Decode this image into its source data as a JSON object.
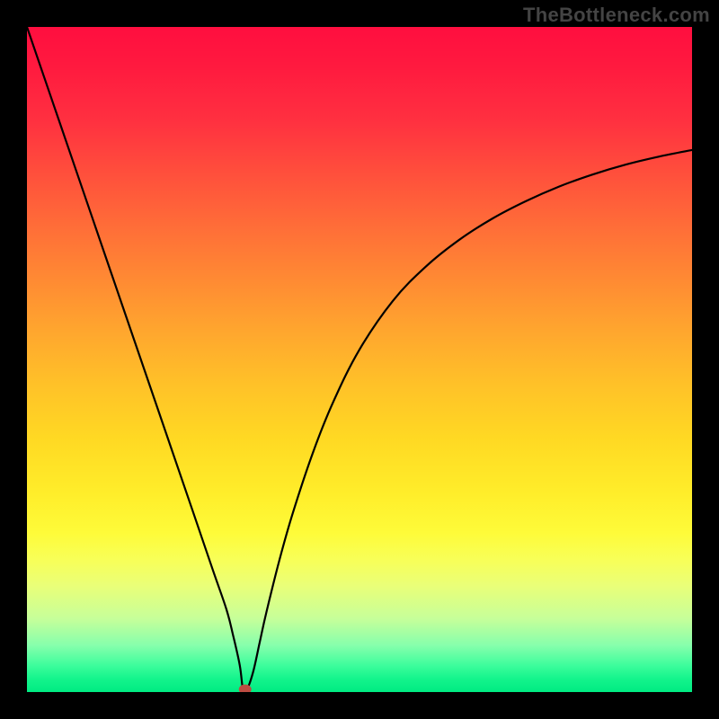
{
  "watermark": "TheBottleneck.com",
  "chart_data": {
    "type": "line",
    "title": "",
    "xlabel": "",
    "ylabel": "",
    "xlim": [
      0,
      100
    ],
    "ylim": [
      0,
      100
    ],
    "grid": false,
    "x": [
      0,
      5,
      10,
      15,
      20,
      25,
      28,
      30,
      31,
      32,
      32.5,
      33,
      34,
      35,
      36,
      38,
      40,
      43,
      46,
      50,
      55,
      60,
      65,
      70,
      75,
      80,
      85,
      90,
      95,
      100
    ],
    "y": [
      100,
      85.4,
      70.8,
      56.2,
      41.6,
      27.0,
      18.2,
      12.4,
      8.5,
      4.0,
      0.2,
      0.2,
      3.0,
      7.5,
      12.0,
      20.0,
      27.0,
      36.0,
      43.5,
      51.5,
      58.8,
      64.0,
      68.0,
      71.2,
      73.8,
      76.0,
      77.8,
      79.3,
      80.5,
      81.5
    ],
    "minimum_marker": {
      "x": 32.8,
      "y": 0.4
    },
    "background_gradient": {
      "top": "#ff0e3f",
      "middle": "#ffd923",
      "bottom": "#00eb82"
    }
  }
}
